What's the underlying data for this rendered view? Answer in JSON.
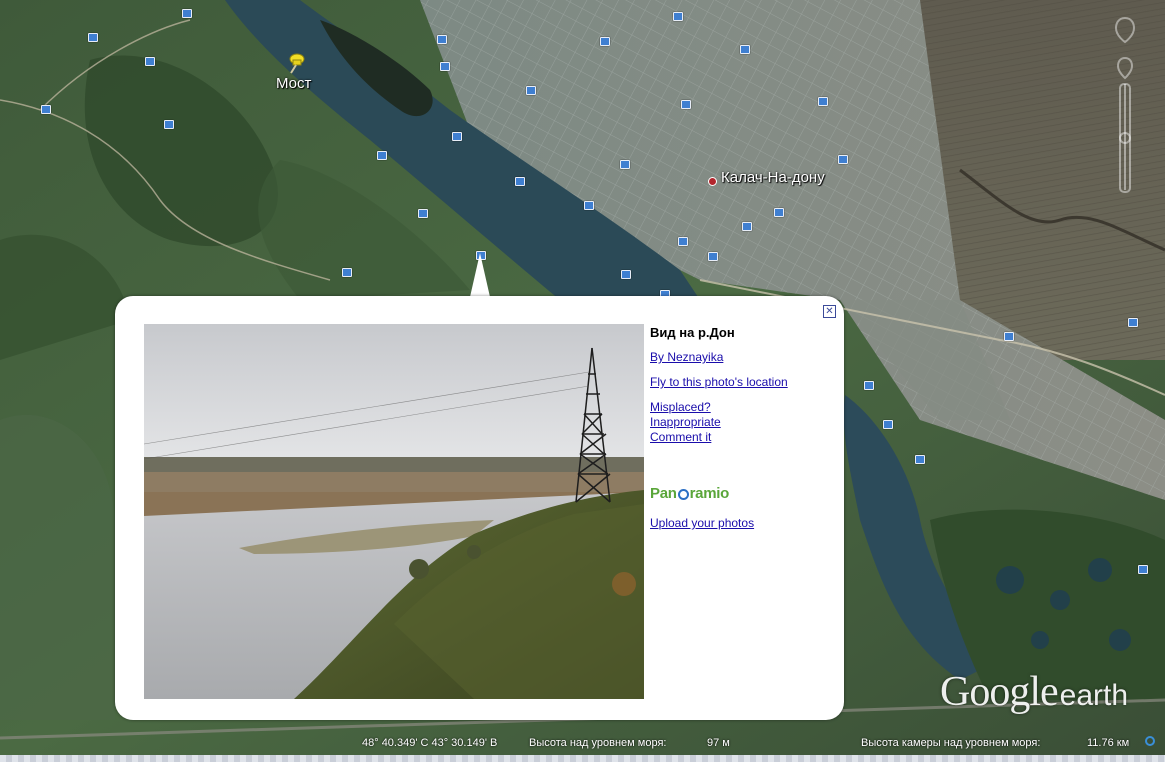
{
  "map": {
    "labels": {
      "bridge": "Мост",
      "town": "Калач-На-дону"
    }
  },
  "balloon": {
    "title": "Вид на р.Дон",
    "author_link": "By Neznayika",
    "fly_link": "Fly to this photo's location",
    "misplaced_link": "Misplaced?",
    "inappropriate_link": "Inappropriate",
    "comment_link": "Comment it",
    "brand_before": "Pan",
    "brand_after": "ramio",
    "upload_link": "Upload your photos",
    "close_symbol": "✕"
  },
  "logo": {
    "google": "Google",
    "earth": "earth"
  },
  "status": {
    "coordinates": "48° 40.349' С  43° 30.149' В",
    "elevation_label": "Высота над уровнем моря:",
    "elevation_value": "97 м",
    "camera_label": "Высота камеры над уровнем моря:",
    "camera_value": "11.76 км"
  },
  "icons": [
    "pushpin-icon",
    "town-dot-icon",
    "photo-marker-icon",
    "close-icon",
    "navigation-control-icon",
    "streaming-icon"
  ]
}
